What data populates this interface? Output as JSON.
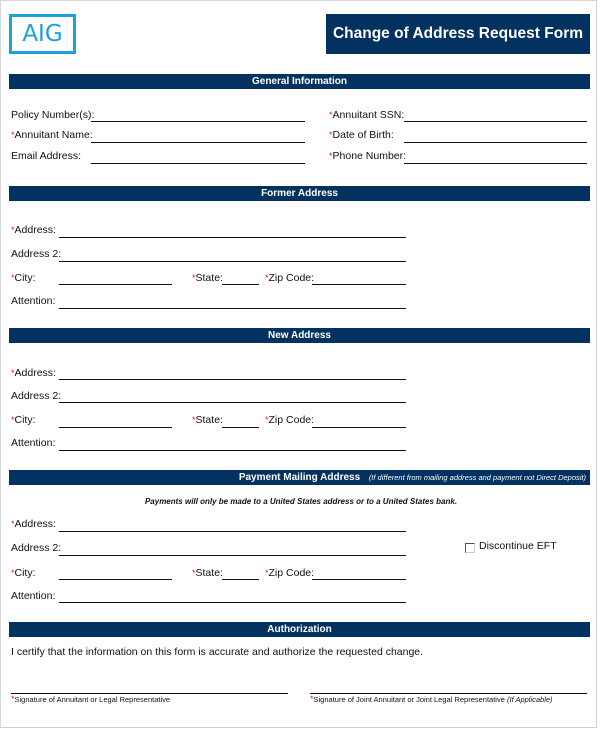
{
  "header": {
    "logo_text": "AIG",
    "title": "Change of Address Request Form"
  },
  "colors": {
    "brand_navy": "#033160",
    "logo_blue": "#1aa2e0",
    "required_red": "#e02020"
  },
  "required_marker": "*",
  "general_information": {
    "heading": "General Information",
    "left_fields": [
      {
        "label": "Policy Number(s):",
        "required": false,
        "value": ""
      },
      {
        "label": "Annuitant Name:",
        "required": true,
        "value": ""
      },
      {
        "label": "Email Address:",
        "required": false,
        "value": ""
      }
    ],
    "right_fields": [
      {
        "label": "Annuitant SSN:",
        "required": true,
        "value": ""
      },
      {
        "label": "Date of Birth:",
        "required": true,
        "value": ""
      },
      {
        "label": "Phone Number:",
        "required": true,
        "value": ""
      }
    ]
  },
  "former_address": {
    "heading": "Former Address",
    "address": "Address:",
    "address2": "Address 2:",
    "city": "City:",
    "state": "State:",
    "zip": "Zip Code:",
    "attention": "Attention:"
  },
  "new_address": {
    "heading": "New Address",
    "address": "Address:",
    "address2": "Address 2:",
    "city": "City:",
    "state": "State:",
    "zip": "Zip Code:",
    "attention": "Attention:"
  },
  "payment_mailing_address": {
    "heading": "Payment Mailing Address",
    "heading_note": "(If different from mailing address and payment not Direct Deposit)",
    "notice": "Payments will only be made to a United States address or to a United States bank.",
    "address": "Address:",
    "address2": "Address 2:",
    "city": "City:",
    "state": "State:",
    "zip": "Zip Code:",
    "attention": "Attention:",
    "discontinue_eft": {
      "label": "Discontinue EFT",
      "checked": false
    }
  },
  "authorization": {
    "heading": "Authorization",
    "certification": "I certify that the information on this form is accurate and authorize the requested change.",
    "signature_1": "Signature of Annuitant or Legal Representative",
    "signature_2": "Signature of Joint Annuitant or Joint Legal Representative",
    "signature_2_note": "(If Applicable)"
  }
}
